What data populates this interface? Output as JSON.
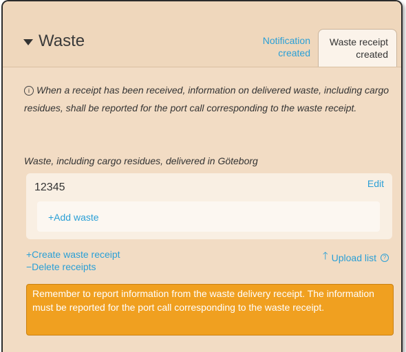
{
  "section": {
    "title": "Waste"
  },
  "tabs": {
    "notification": [
      "Notification",
      "created"
    ],
    "receipt": [
      "Waste receipt",
      "created"
    ]
  },
  "info": {
    "text": "When a receipt has been received, information on delivered waste, including cargo residues, shall be reported for the port call corresponding to the waste receipt.",
    "icon_glyph": "i"
  },
  "delivered": {
    "label": "Waste, including cargo residues, delivered in Göteborg",
    "receipt_number": "12345",
    "edit_label": "Edit",
    "add_waste_label": "+Add waste"
  },
  "actions": {
    "create_label": "+Create waste receipt",
    "delete_label": "−Delete receipts",
    "upload_label": "Upload list",
    "upload_arrow": "🡑",
    "help_glyph": "?"
  },
  "warning": {
    "text": "Remember to report information from the waste delivery receipt. The information must be reported for the port call corresponding to the waste receipt."
  },
  "colors": {
    "panel_bg": "#f2dcc4",
    "link": "#2a9fd6",
    "warning_bg": "#f0a020"
  }
}
